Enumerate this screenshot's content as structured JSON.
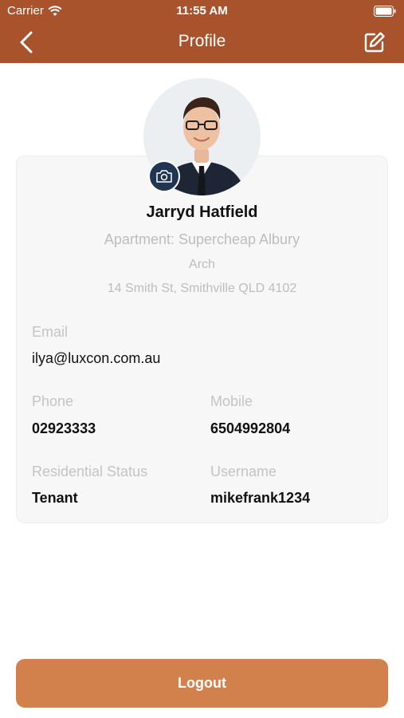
{
  "status_bar": {
    "carrier": "Carrier",
    "time": "11:55 AM"
  },
  "nav": {
    "title": "Profile"
  },
  "profile": {
    "name": "Jarryd Hatfield",
    "apartment": "Apartment: Supercheap Albury",
    "address_line1": "Arch",
    "address_line2": "14 Smith St, Smithville QLD 4102"
  },
  "fields": {
    "email_label": "Email",
    "email_value": "ilya@luxcon.com.au",
    "phone_label": "Phone",
    "phone_value": "02923333",
    "mobile_label": "Mobile",
    "mobile_value": "6504992804",
    "residential_status_label": "Residential Status",
    "residential_status_value": "Tenant",
    "username_label": "Username",
    "username_value": "mikefrank1234"
  },
  "logout_label": "Logout",
  "colors": {
    "header": "#a9532c",
    "logout_button": "#d2814c",
    "camera_badge": "#1f3551"
  },
  "icons": [
    "wifi-icon",
    "battery-icon",
    "back-chevron-icon",
    "edit-icon",
    "camera-icon"
  ]
}
